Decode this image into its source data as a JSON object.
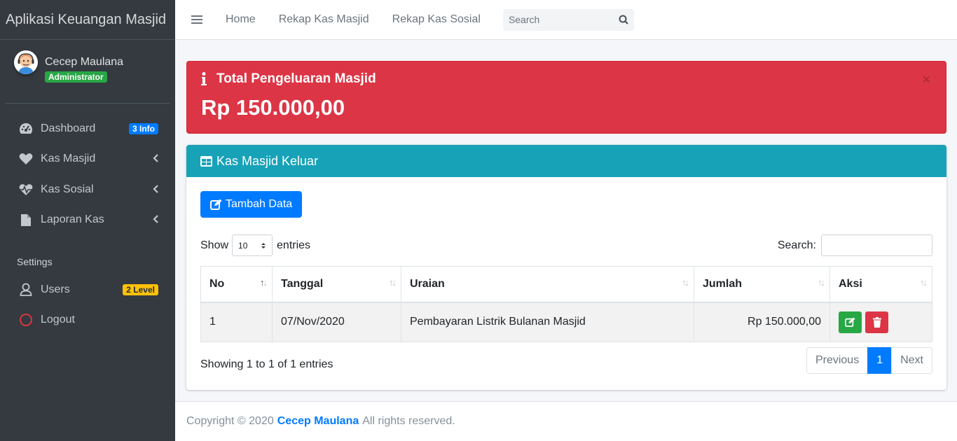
{
  "app": {
    "title": "Aplikasi Keuangan Masjid"
  },
  "user": {
    "name": "Cecep Maulana",
    "role": "Administrator"
  },
  "sidebar": {
    "items": [
      {
        "label": "Dashboard",
        "icon": "tachometer-icon",
        "badge": "3 Info"
      },
      {
        "label": "Kas Masjid",
        "icon": "heart-icon"
      },
      {
        "label": "Kas Sosial",
        "icon": "heartbeat-icon"
      },
      {
        "label": "Laporan Kas",
        "icon": "file-icon"
      }
    ],
    "settings_header": "Settings",
    "settings": [
      {
        "label": "Users",
        "icon": "user-icon",
        "badge": "2 Level"
      },
      {
        "label": "Logout",
        "icon": "circle-icon"
      }
    ]
  },
  "topnav": {
    "links": [
      "Home",
      "Rekap Kas Masjid",
      "Rekap Kas Sosial"
    ],
    "search_placeholder": "Search"
  },
  "alert": {
    "title": "Total Pengeluaran Masjid",
    "value": "Rp 150.000,00",
    "close": "×"
  },
  "card": {
    "title": "Kas Masjid Keluar",
    "add_button": "Tambah Data",
    "show_label": "Show",
    "page_length": "10",
    "entries_label": "entries",
    "search_label": "Search:",
    "columns": [
      "No",
      "Tanggal",
      "Uraian",
      "Jumlah",
      "Aksi"
    ],
    "rows": [
      {
        "no": "1",
        "tanggal": "07/Nov/2020",
        "uraian": "Pembayaran Listrik Bulanan Masjid",
        "jumlah": "Rp 150.000,00"
      }
    ],
    "info": "Showing 1 to 1 of 1 entries",
    "pagination": {
      "previous": "Previous",
      "current": "1",
      "next": "Next"
    }
  },
  "footer": {
    "prefix": "Copyright © 2020",
    "author": "Cecep Maulana",
    "suffix": "All rights reserved."
  },
  "colors": {
    "danger": "#dc3545",
    "info": "#17a2b8",
    "primary": "#007bff",
    "success": "#28a745",
    "sidebar": "#343a40"
  }
}
